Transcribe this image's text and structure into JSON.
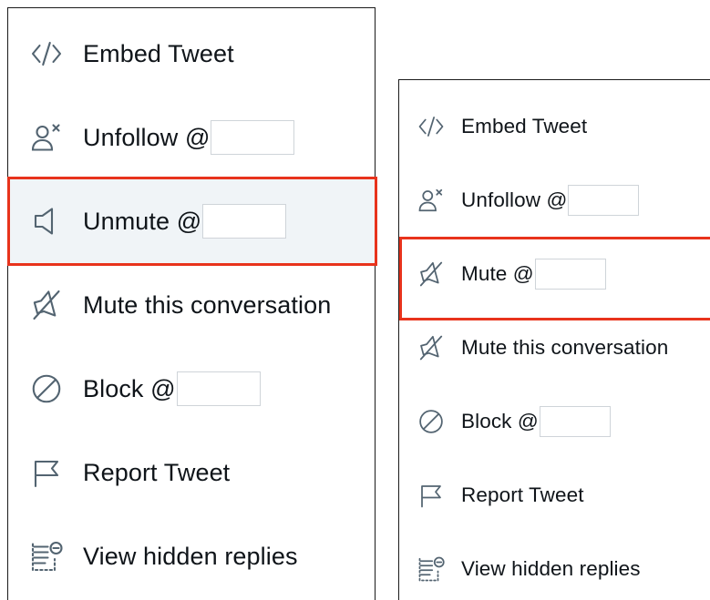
{
  "highlight_color": "#e8331c",
  "left_menu": {
    "items": [
      {
        "icon": "code-icon",
        "label": "Embed Tweet"
      },
      {
        "icon": "unfollow-user-icon",
        "label": "Unfollow @"
      },
      {
        "icon": "speaker-icon",
        "label": "Unmute @",
        "highlighted": true
      },
      {
        "icon": "mute-speaker-icon",
        "label": "Mute this conversation"
      },
      {
        "icon": "block-icon",
        "label": "Block @"
      },
      {
        "icon": "flag-icon",
        "label": "Report Tweet"
      },
      {
        "icon": "hidden-replies-icon",
        "label": "View hidden replies"
      }
    ]
  },
  "right_menu": {
    "items": [
      {
        "icon": "code-icon",
        "label": "Embed Tweet"
      },
      {
        "icon": "unfollow-user-icon",
        "label": "Unfollow @"
      },
      {
        "icon": "mute-speaker-icon",
        "label": "Mute @",
        "highlighted": true
      },
      {
        "icon": "mute-speaker-icon",
        "label": "Mute this conversation"
      },
      {
        "icon": "block-icon",
        "label": "Block @"
      },
      {
        "icon": "flag-icon",
        "label": "Report Tweet"
      },
      {
        "icon": "hidden-replies-icon",
        "label": "View hidden replies"
      }
    ]
  }
}
